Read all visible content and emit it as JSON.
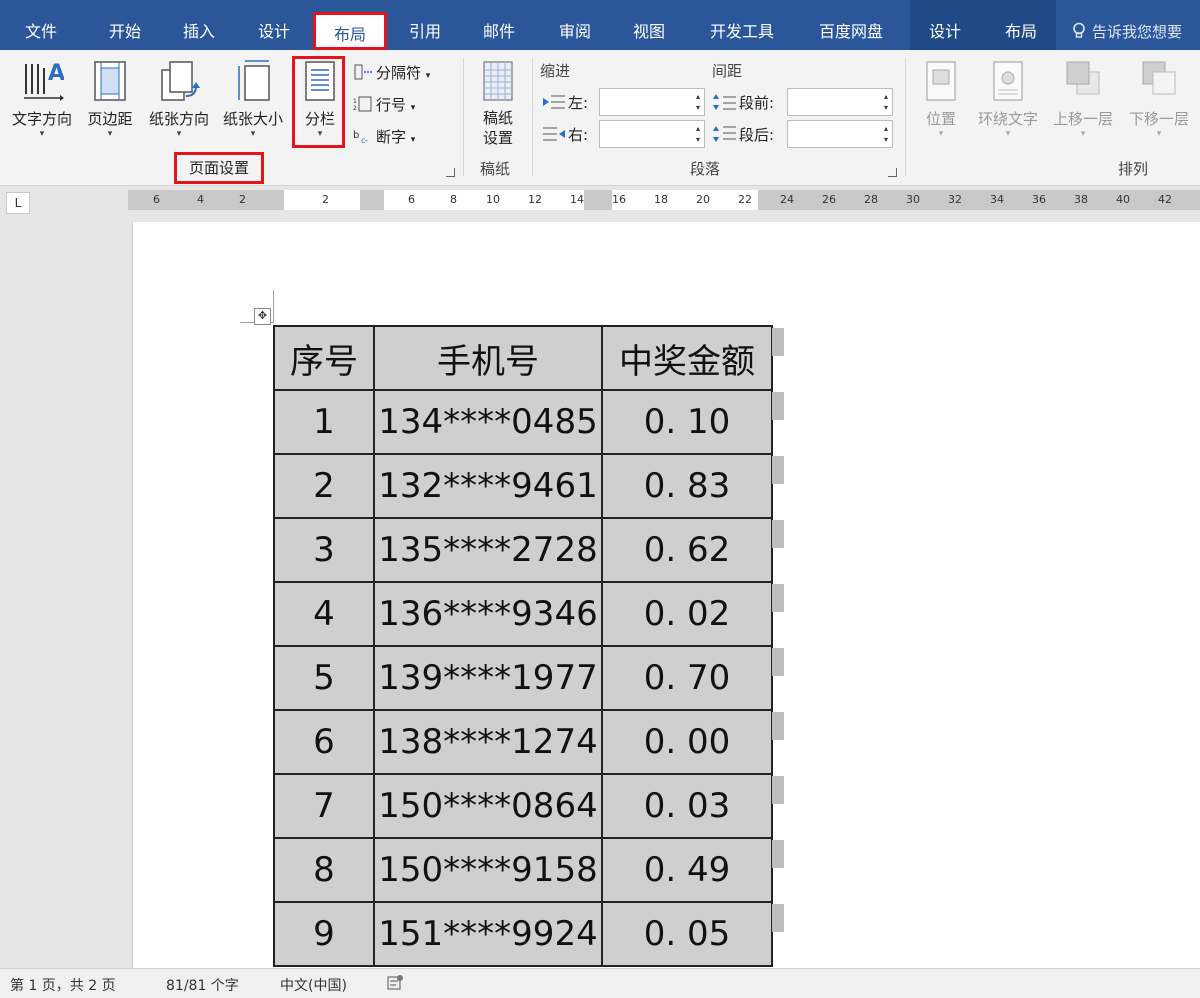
{
  "tabs": [
    {
      "label": "文件"
    },
    {
      "label": "开始"
    },
    {
      "label": "插入"
    },
    {
      "label": "设计"
    },
    {
      "label": "布局"
    },
    {
      "label": "引用"
    },
    {
      "label": "邮件"
    },
    {
      "label": "审阅"
    },
    {
      "label": "视图"
    },
    {
      "label": "开发工具"
    },
    {
      "label": "百度网盘"
    },
    {
      "label": "设计"
    },
    {
      "label": "布局"
    }
  ],
  "active_tab": "布局",
  "tell_me": "告诉我您想要",
  "ribbon": {
    "page_setup": {
      "text_direction": "文字方向",
      "margins": "页边距",
      "orientation": "纸张方向",
      "size": "纸张大小",
      "columns": "分栏",
      "breaks": "分隔符",
      "line_numbers": "行号",
      "hyphenation": "断字",
      "group_label": "页面设置"
    },
    "paper": {
      "label_line1": "稿纸",
      "label_line2": "设置",
      "group_label": "稿纸"
    },
    "paragraph": {
      "indent_header": "缩进",
      "spacing_header": "间距",
      "left": "左:",
      "right": "右:",
      "before": "段前:",
      "after": "段后:",
      "group_label": "段落"
    },
    "arrange": {
      "position": "位置",
      "wrap_text": "环绕文字",
      "bring_forward": "上移一层",
      "send_backward": "下移一层",
      "group_label": "排列"
    }
  },
  "ruler": {
    "corner": "L",
    "left_numbers": [
      "6",
      "4",
      "2"
    ],
    "mid_number": "2",
    "numbers": [
      "6",
      "8",
      "10",
      "12",
      "14",
      "16",
      "18",
      "20",
      "22",
      "24",
      "26",
      "28",
      "30",
      "32",
      "34",
      "36",
      "38",
      "40",
      "42"
    ]
  },
  "table": {
    "headers": [
      "序号",
      "手机号",
      "中奖金额"
    ],
    "rows": [
      [
        "1",
        "134****0485",
        "0. 10"
      ],
      [
        "2",
        "132****9461",
        "0. 83"
      ],
      [
        "3",
        "135****2728",
        "0. 62"
      ],
      [
        "4",
        "136****9346",
        "0. 02"
      ],
      [
        "5",
        "139****1977",
        "0. 70"
      ],
      [
        "6",
        "138****1274",
        "0. 00"
      ],
      [
        "7",
        "150****0864",
        "0. 03"
      ],
      [
        "8",
        "150****9158",
        "0. 49"
      ],
      [
        "9",
        "151****9924",
        "0. 05"
      ]
    ]
  },
  "status": {
    "page": "第 1 页，共 2 页",
    "words": "81/81 个字",
    "language": "中文(中国)"
  },
  "colors": {
    "tab_bar": "#2b579a",
    "highlight": "#e3141c",
    "cell_shading": "#cfcfcf"
  }
}
